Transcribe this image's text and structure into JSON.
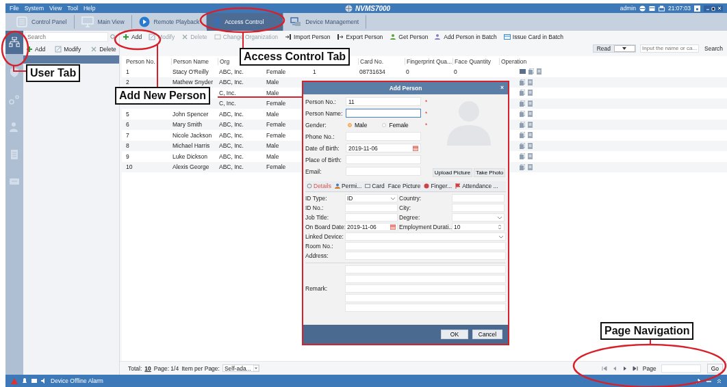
{
  "menu": [
    "File",
    "System",
    "View",
    "Tool",
    "Help"
  ],
  "app_title": "NVMS7000",
  "status_right": {
    "user": "admin",
    "time": "21:07:03"
  },
  "tabs": [
    {
      "label": "Control Panel",
      "selected": false
    },
    {
      "label": "Main View",
      "selected": false
    },
    {
      "label": "Remote Playback",
      "selected": false
    },
    {
      "label": "Access Control",
      "selected": true
    },
    {
      "label": "Device Management",
      "selected": false
    }
  ],
  "side_icons": [
    {
      "selected": true
    },
    {
      "selected": false
    },
    {
      "selected": false
    },
    {
      "selected": false
    },
    {
      "selected": false
    },
    {
      "selected": false
    }
  ],
  "org_panel": {
    "search": {
      "placeholder": "Search"
    },
    "actions": [
      "Add",
      "Modify",
      "Delete"
    ]
  },
  "toolbar": [
    {
      "label": "Add",
      "disabled": false
    },
    {
      "label": "Modify",
      "disabled": true
    },
    {
      "label": "Delete",
      "disabled": true
    },
    {
      "label": "Change Organization",
      "disabled": true
    },
    {
      "label": "Import Person",
      "disabled": false
    },
    {
      "label": "Export Person",
      "disabled": false
    },
    {
      "label": "Get Person",
      "disabled": false
    },
    {
      "label": "Add Person in Batch",
      "disabled": false
    },
    {
      "label": "Issue Card in Batch",
      "disabled": false
    }
  ],
  "reader": {
    "mode": "Read",
    "search": {
      "placeholder": "Input the name or ca..."
    },
    "button": "Search"
  },
  "table": {
    "columns": [
      {
        "label": "Person No."
      },
      {
        "label": "Person Name"
      },
      {
        "label": "Org"
      },
      {},
      {},
      {
        "label": "Card No."
      },
      {
        "label": "Fingerprint Qua..."
      },
      {
        "label": "Face Quantity"
      },
      {
        "label": "Operation"
      }
    ],
    "rows": [
      {
        "cells": [
          "1",
          "Stacy O'Reilly",
          "ABC, Inc.",
          "Female",
          "1",
          "08731634",
          "0",
          "0"
        ],
        "card": true
      },
      {
        "cells": [
          "2",
          "Mathew Snyder",
          "ABC, Inc.",
          "Male"
        ],
        "card": false
      },
      {
        "cells": [
          "",
          "",
          "C, Inc.",
          "Male"
        ],
        "card": false
      },
      {
        "cells": [
          "",
          "",
          "C, Inc.",
          "Female"
        ],
        "card": false
      },
      {
        "cells": [
          "5",
          "John Spencer",
          "ABC, Inc.",
          "Male"
        ],
        "card": false
      },
      {
        "cells": [
          "6",
          "Mary Smith",
          "ABC, Inc.",
          "Female"
        ],
        "card": false
      },
      {
        "cells": [
          "7",
          "Nicole Jackson",
          "ABC, Inc.",
          "Female"
        ],
        "card": false
      },
      {
        "cells": [
          "8",
          "Michael Harris",
          "ABC, Inc.",
          "Male"
        ],
        "card": false
      },
      {
        "cells": [
          "9",
          "Luke Dickson",
          "ABC, Inc.",
          "Male"
        ],
        "card": false
      },
      {
        "cells": [
          "10",
          "Alexis George",
          "ABC, Inc.",
          "Female"
        ],
        "card": false
      }
    ]
  },
  "footer": {
    "total_label": "Total:",
    "total": "10",
    "page_label": "Page: 1/4",
    "per_page_label": "Item per Page:",
    "per_page": "Self-ada...",
    "nav_page_label": "Page",
    "go": "Go"
  },
  "status_bar": {
    "alarm": "Device Offline Alarm"
  },
  "dialog": {
    "title": "Add Person",
    "close": "×",
    "fields": [
      {
        "label": "Person No.:",
        "kind": "text",
        "value": "11",
        "mark": "*",
        "focused": false
      },
      {
        "label": "Person Name:",
        "kind": "text",
        "mark": "*",
        "focused": true
      },
      {
        "label": "Gender:",
        "kind": "radio",
        "options": [
          {
            "label": "Male",
            "selected": true
          },
          {
            "label": "Female",
            "selected": false
          }
        ],
        "mark": "*"
      },
      {
        "label": "Phone No.:",
        "kind": "text",
        "focused": false
      },
      {
        "label": "Date of Birth:",
        "kind": "date",
        "value": "2019-11-06",
        "focused": false
      },
      {
        "label": "Place of Birth:",
        "kind": "text",
        "focused": false
      },
      {
        "label": "Email:",
        "kind": "text",
        "focused": false
      }
    ],
    "photo_buttons": [
      "Upload Picture",
      "Take Photo"
    ],
    "tabs": [
      {
        "label": "Details",
        "selected": true
      },
      {
        "label": "Permi...",
        "selected": false
      },
      {
        "label": "Card",
        "selected": false
      },
      {
        "label": "Face Picture",
        "selected": false
      },
      {
        "label": "Finger...",
        "selected": false
      },
      {
        "label": "Attendance ...",
        "selected": false
      }
    ],
    "details": [
      [
        {
          "label": "ID Type:",
          "kind": "select",
          "value": "ID"
        },
        {
          "label": "Country:",
          "kind": "text"
        }
      ],
      [
        {
          "label": "ID No.:",
          "kind": "text"
        },
        {
          "label": "City:",
          "kind": "text"
        }
      ],
      [
        {
          "label": "Job Title:",
          "kind": "text"
        },
        {
          "label": "Degree:",
          "kind": "select"
        }
      ],
      [
        {
          "label": "On Board Date:",
          "kind": "date",
          "value": "2019-11-06"
        },
        {
          "label": "Employment Durati...",
          "kind": "spin",
          "value": "10"
        }
      ],
      [
        {
          "label": "Linked Device:",
          "kind": "wideselect"
        }
      ],
      [
        {
          "label": "Room No.:",
          "kind": "wide"
        }
      ],
      [
        {
          "label": "Address:",
          "kind": "wide"
        }
      ]
    ],
    "remark": "Remark:",
    "buttons": [
      "OK",
      "Cancel"
    ]
  },
  "callouts": [
    {
      "label": "User Tab",
      "kind": "user"
    },
    {
      "label": "Access Control Tab",
      "kind": "tab"
    },
    {
      "label": "Add New Person",
      "kind": "add"
    },
    {
      "label": "Page Navigation",
      "kind": "nav"
    }
  ]
}
